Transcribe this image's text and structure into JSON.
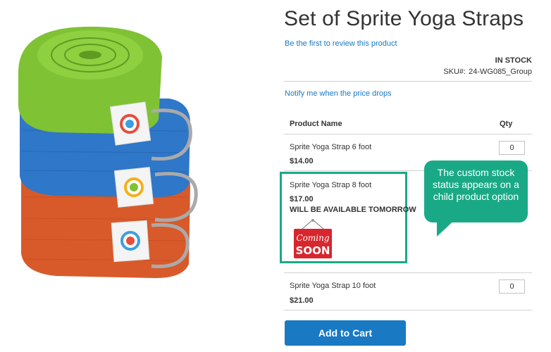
{
  "product": {
    "title": "Set of Sprite Yoga Straps",
    "review_link": "Be the first to review this product",
    "stock_status": "IN STOCK",
    "sku_label": "SKU#:",
    "sku_value": "24-WG085_Group",
    "notify_link": "Notify me when the price drops"
  },
  "table": {
    "col_name": "Product Name",
    "col_qty": "Qty",
    "rows": [
      {
        "name": "Sprite Yoga Strap 6 foot",
        "price": "$14.00",
        "qty": "0"
      },
      {
        "name": "Sprite Yoga Strap 8 foot",
        "price": "$17.00",
        "status": "WILL BE AVAILABLE TOMORROW",
        "badge": {
          "line1": "Coming",
          "line2": "SOON"
        }
      },
      {
        "name": "Sprite Yoga Strap 10 foot",
        "price": "$21.00",
        "qty": "0"
      }
    ]
  },
  "actions": {
    "add_to_cart": "Add to Cart"
  },
  "callout": {
    "text": "The custom stock status appears on a child product option"
  },
  "colors": {
    "link": "#1979c3",
    "button": "#1979c3",
    "highlight": "#1aa986",
    "strap_green": "#7fc234",
    "strap_blue": "#2f77c8",
    "strap_orange": "#d85a2a",
    "badge_red": "#d7262e"
  },
  "icons": {
    "product_image": "yoga-straps-image",
    "badge": "coming-soon-sign"
  }
}
